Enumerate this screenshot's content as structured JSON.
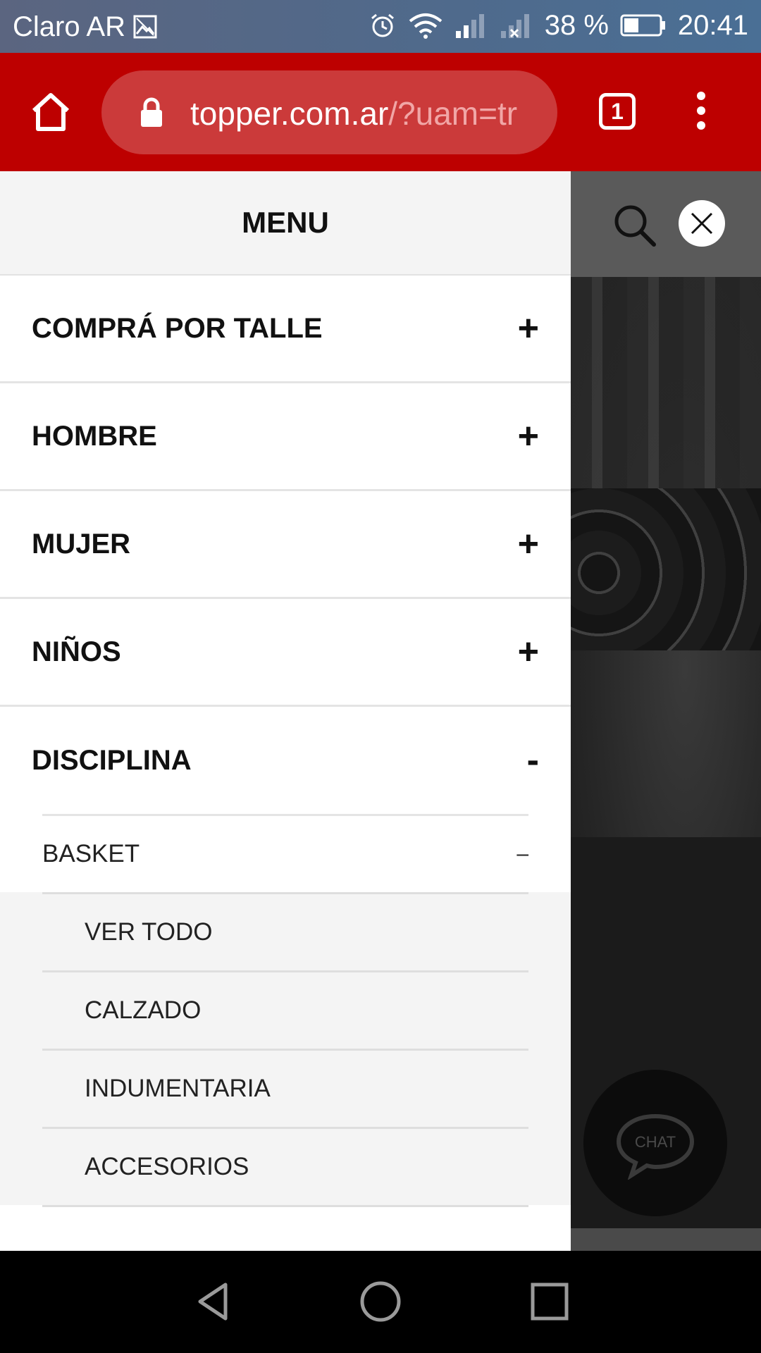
{
  "status_bar": {
    "carrier": "Claro AR",
    "battery": "38 %",
    "time": "20:41"
  },
  "browser": {
    "url_host": "topper.com.ar",
    "url_path": "/?uam=tr",
    "tab_count": "1"
  },
  "drawer": {
    "title": "MENU",
    "items": [
      {
        "label": "COMPRÁ POR TALLE",
        "toggle": "+"
      },
      {
        "label": "HOMBRE",
        "toggle": "+"
      },
      {
        "label": "MUJER",
        "toggle": "+"
      },
      {
        "label": "NIÑOS",
        "toggle": "+"
      },
      {
        "label": "DISCIPLINA",
        "toggle": "-"
      }
    ],
    "disciplina": {
      "sub_label": "BASKET",
      "sub_toggle": "–",
      "sub_items": [
        "VER TODO",
        "CALZADO",
        "INDUMENTARIA",
        "ACCESORIOS"
      ]
    }
  },
  "page": {
    "chat_label": "CHAT"
  },
  "colors": {
    "browser_bar": "#bd0000",
    "url_pill": "#cb3a3a",
    "drawer_bg": "#ffffff",
    "sub_list_bg": "#f4f4f4"
  },
  "icons": [
    "home-icon",
    "lock-icon",
    "tabs-icon",
    "overflow-menu-icon",
    "search-icon",
    "close-icon",
    "chat-icon",
    "back-icon",
    "home-nav-icon",
    "recents-icon"
  ]
}
